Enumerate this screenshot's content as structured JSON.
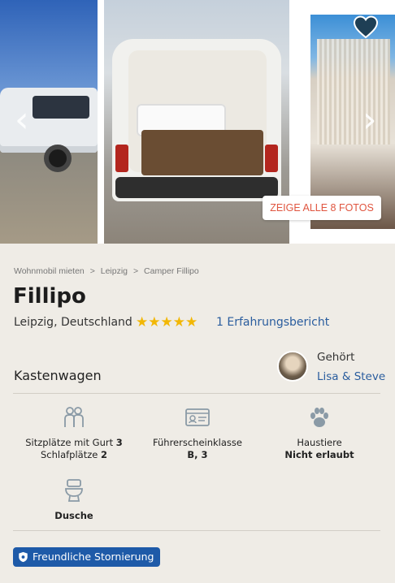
{
  "gallery": {
    "show_all_label": "ZEIGE ALLE 8 FOTOS",
    "favorite_icon": "heart-icon",
    "prev_icon": "chevron-left-icon",
    "next_icon": "chevron-right-icon"
  },
  "breadcrumb": {
    "items": [
      "Wohnmobil mieten",
      "Leipzig",
      "Camper Fillipo"
    ],
    "separator": ">"
  },
  "listing": {
    "title": "Fillipo",
    "location": "Leipzig, Deutschland",
    "rating_stars": "★★★★★",
    "rating_value": 5,
    "reviews_label": "1 Erfahrungsbericht",
    "vehicle_type": "Kastenwagen"
  },
  "owner": {
    "label": "Gehört",
    "name": "Lisa & Steve"
  },
  "features": {
    "seats_label": "Sitzplätze mit Gurt",
    "seats_value": "3",
    "beds_label": "Schlafplätze",
    "beds_value": "2",
    "license_label": "Führerscheinklasse",
    "license_value": "B, 3",
    "pets_label": "Haustiere",
    "pets_value": "Nicht erlaubt",
    "shower_label": "Dusche"
  },
  "badge": {
    "label": "Freundliche Stornierung",
    "icon": "shield-icon"
  },
  "colors": {
    "accent_blue": "#1e5aa8",
    "link_blue": "#2a5d9e",
    "star_yellow": "#f2b705",
    "cta_red": "#e0553f",
    "panel_bg": "#efece6",
    "icon_gray": "#8a9aa6"
  }
}
